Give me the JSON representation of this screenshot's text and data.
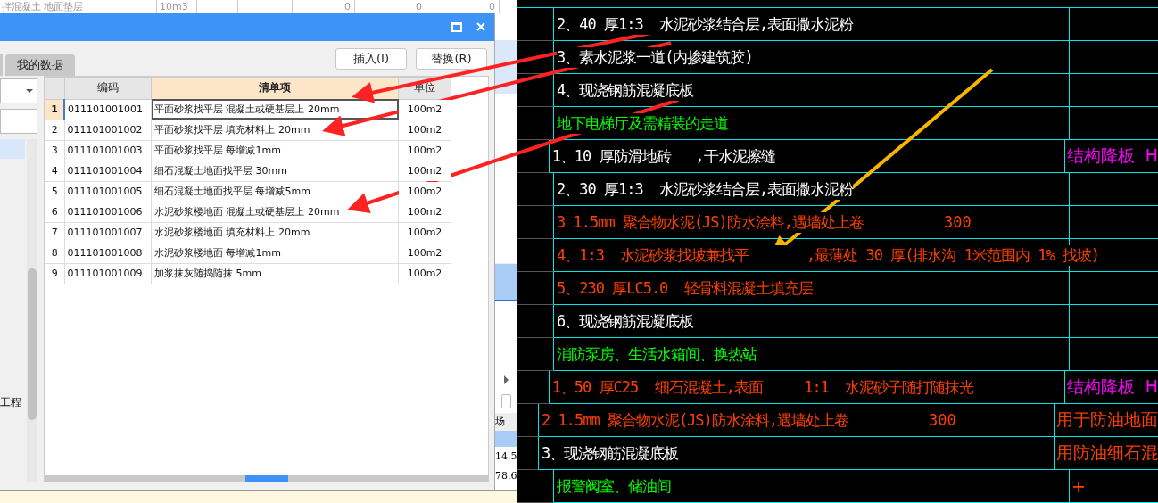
{
  "background_top_row": {
    "name": "拌混凝土 地面垫层",
    "unit": "10m3",
    "values": [
      "0",
      "0",
      "0"
    ]
  },
  "dialog": {
    "tabs": [
      {
        "label": "我的数据",
        "selected": false
      }
    ],
    "buttons": [
      "插入(I)",
      "替换(R)"
    ],
    "side_panel": {
      "items": [
        {
          "label": "工程",
          "selected": false
        }
      ]
    },
    "table": {
      "columns": [
        "编码",
        "清单项",
        "单位"
      ],
      "rows": [
        {
          "index": "1",
          "code": "011101001001",
          "item": "平面砂浆找平层 混凝土或硬基层上 20mm",
          "unit": "100m2",
          "selected": true
        },
        {
          "index": "2",
          "code": "011101001002",
          "item": "平面砂浆找平层 填充材料上 20mm",
          "unit": "100m2",
          "selected": false
        },
        {
          "index": "3",
          "code": "011101001003",
          "item": "平面砂浆找平层 每增减1mm",
          "unit": "100m2",
          "selected": false
        },
        {
          "index": "4",
          "code": "011101001004",
          "item": "细石混凝土地面找平层 30mm",
          "unit": "100m2",
          "selected": false
        },
        {
          "index": "5",
          "code": "011101001005",
          "item": "细石混凝土地面找平层 每增减5mm",
          "unit": "100m2",
          "selected": false
        },
        {
          "index": "6",
          "code": "011101001006",
          "item": "水泥砂浆楼地面 混凝土或硬基层上 20mm",
          "unit": "100m2",
          "selected": false
        },
        {
          "index": "7",
          "code": "011101001007",
          "item": "水泥砂浆楼地面 填充材料上 20mm",
          "unit": "100m2",
          "selected": false
        },
        {
          "index": "8",
          "code": "011101001008",
          "item": "水泥砂浆楼地面 每增减1mm",
          "unit": "100m2",
          "selected": false
        },
        {
          "index": "9",
          "code": "011101001009",
          "item": "加浆抹灰随捣随抹 5mm",
          "unit": "100m2",
          "selected": false
        }
      ]
    }
  },
  "background_side": {
    "header": "场",
    "cells": [
      "14.5",
      "78.6"
    ]
  },
  "cad_table": {
    "rows": [
      {
        "text": "2、40 厚1:3  水泥砂浆结合层,表面撒水泥粉",
        "color": "#ffffff"
      },
      {
        "text": "3、素水泥浆一道(内掺建筑胶)",
        "color": "#ffffff"
      },
      {
        "text": "4、现浇钢筋混凝底板",
        "color": "#ffffff"
      },
      {
        "text": "地下电梯厅及需精装的走道",
        "color": "#00ff00"
      },
      {
        "text": "1、10 厚防滑地砖   ,干水泥擦缝",
        "color": "#ffffff",
        "note": {
          "text": "结构降板  H",
          "color": "#ff00ff"
        }
      },
      {
        "text": "2、30 厚1:3  水泥砂浆结合层,表面撒水泥粉",
        "color": "#ffffff"
      },
      {
        "text": "3 1.5mm 聚合物水泥(JS)防水涂料,遇墙处上卷",
        "extra": "300",
        "color": "#ff3f00"
      },
      {
        "text": "4、1:3  水泥砂浆找坡兼找平       ,最薄处 30 厚(排水沟 1米范围内 1% 找坡)",
        "color": "#ff3f00"
      },
      {
        "text": "5、230 厚LC5.0  轻骨料混凝土填充层",
        "color": "#ff3f00"
      },
      {
        "text": "6、现浇钢筋混凝底板",
        "color": "#ffffff"
      },
      {
        "text": "消防泵房、生活水箱间、换热站",
        "color": "#00ff00"
      },
      {
        "text": "1、50 厚C25  细石混凝土,表面     1:1  水泥砂子随打随抹光",
        "color": "#ff3f00",
        "note": {
          "text": "结构降板  H",
          "color": "#ff00ff"
        }
      },
      {
        "text": "2 1.5mm 聚合物水泥(JS)防水涂料,遇墙处上卷",
        "extra": "300",
        "color": "#ff3f00",
        "note": {
          "text": "用于防油地面",
          "color": "#ff3f00"
        }
      },
      {
        "text": "3、现浇钢筋混凝底板",
        "color": "#ffffff",
        "note": {
          "text": "用防油细石混",
          "color": "#ff3f00"
        }
      },
      {
        "text": "报警阀室、储油间",
        "color": "#00ff00",
        "note": {
          "text": "+",
          "color": "#ff3f00"
        }
      }
    ]
  }
}
